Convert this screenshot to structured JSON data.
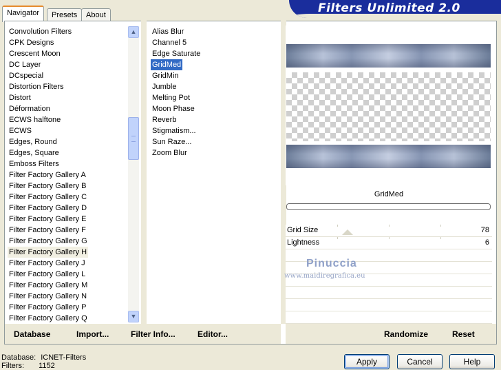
{
  "tabs": [
    {
      "label": "Navigator",
      "active": true
    },
    {
      "label": "Presets",
      "active": false
    },
    {
      "label": "About",
      "active": false
    }
  ],
  "banner": {
    "title": "Filters Unlimited 2.0"
  },
  "categories": [
    "Convolution Filters",
    "CPK Designs",
    "Crescent Moon",
    "DC Layer",
    "DCspecial",
    "Distortion Filters",
    "Distort",
    "Déformation",
    "ECWS halftone",
    "ECWS",
    "Edges, Round",
    "Edges, Square",
    "Emboss Filters",
    "Filter Factory Gallery A",
    "Filter Factory Gallery B",
    "Filter Factory Gallery C",
    "Filter Factory Gallery D",
    "Filter Factory Gallery E",
    "Filter Factory Gallery F",
    "Filter Factory Gallery G",
    "Filter Factory Gallery H",
    "Filter Factory Gallery J",
    "Filter Factory Gallery L",
    "Filter Factory Gallery M",
    "Filter Factory Gallery N",
    "Filter Factory Gallery P",
    "Filter Factory Gallery Q"
  ],
  "selected_category_index": 20,
  "filters": [
    "Alias Blur",
    "Channel 5",
    "Edge Saturate",
    "GridMed",
    "GridMin",
    "Jumble",
    "Melting Pot",
    "Moon Phase",
    "Reverb",
    "Stigmatism...",
    "Sun Raze...",
    "Zoom Blur"
  ],
  "selected_filter_index": 3,
  "preview": {
    "filter_name": "GridMed"
  },
  "params": [
    {
      "label": "Grid Size",
      "value": "78"
    },
    {
      "label": "Lightness",
      "value": "6"
    }
  ],
  "watermark": {
    "name": "Pinuccia",
    "site": "www.maidiregrafica.eu"
  },
  "links": {
    "database": "Database",
    "import": "Import...",
    "filter_info": "Filter Info...",
    "editor": "Editor...",
    "randomize": "Randomize",
    "reset": "Reset"
  },
  "status": {
    "database_label": "Database:",
    "database_value": "ICNET-Filters",
    "filters_label": "Filters:",
    "filters_value": "1152"
  },
  "buttons": {
    "apply": "Apply",
    "cancel": "Cancel",
    "help": "Help"
  },
  "icons": {
    "scroll_up": "▲",
    "scroll_down": "▼"
  }
}
